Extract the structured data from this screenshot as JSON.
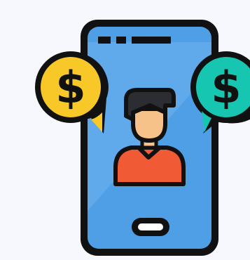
{
  "illustration": {
    "subject": "phone-with-user-and-dollar-bubbles",
    "icons": [
      "phone-icon",
      "user-avatar-icon",
      "dollar-bubble-icon",
      "dollar-bubble-icon"
    ],
    "colors": {
      "background": "#f6f8fe",
      "outline": "#111111",
      "screen": "#4f9fe6",
      "screen_highlight": "#6db3f0",
      "coin_left": "#f7c828",
      "coin_right": "#16c6b1",
      "shirt": "#f05a35",
      "skin": "#f7c18a",
      "hair": "#2c2d33",
      "home_button": "#ffffff"
    }
  },
  "coins": {
    "left_symbol": "$",
    "right_symbol": "$"
  }
}
